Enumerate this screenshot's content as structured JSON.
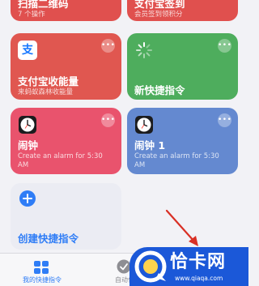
{
  "cards": [
    {
      "id": "scan-qr",
      "title": "扫描二维码",
      "subtitle": "7 个操作",
      "color": "#e0504e"
    },
    {
      "id": "alipay-checkin",
      "title": "支付宝签到",
      "subtitle": "会员签到领积分",
      "color": "#e0504e"
    },
    {
      "id": "alipay-energy",
      "title": "支付宝收能量",
      "subtitle": "来蚂蚁森林收能量",
      "color": "#e05750",
      "icon": "alipay-icon",
      "icon_glyph": "支"
    },
    {
      "id": "new-shortcut",
      "title": "新快捷指令",
      "color": "#4ead5d",
      "icon": "loading-spinner-icon"
    },
    {
      "id": "alarm",
      "title": "闹钟",
      "subtitle": "Create an alarm for 5:30 AM",
      "color": "#e9536d",
      "icon": "clock-icon"
    },
    {
      "id": "alarm-1",
      "title": "闹钟 1",
      "subtitle": "Create an alarm for 5:30 AM",
      "color": "#6489d0",
      "icon": "clock-icon"
    }
  ],
  "create_card": {
    "title": "创建快捷指令",
    "icon": "plus-circle-icon",
    "color": "#2f7df6"
  },
  "more_button_glyph": "•••",
  "tabs": [
    {
      "label": "我的快捷指令",
      "icon": "grid-icon",
      "active": true,
      "color": "#2f7df6"
    },
    {
      "label": "自动化",
      "icon": "checkmark-circle-icon",
      "active": false,
      "color": "#8e8e93"
    }
  ],
  "watermark": {
    "text": "恰卡网",
    "url_text": "www.qiaqa.com"
  }
}
